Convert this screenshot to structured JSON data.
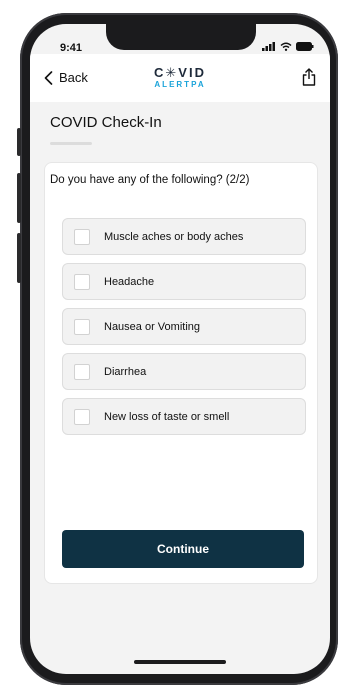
{
  "status_bar": {
    "time": "9:41"
  },
  "nav": {
    "back_label": "Back",
    "logo_top": "C✳VID",
    "logo_bottom": "ALERTPA"
  },
  "page": {
    "title": "COVID Check-In",
    "question": "Do you have any of the following? (2/2)"
  },
  "options": [
    {
      "label": "Muscle aches or body aches",
      "checked": false
    },
    {
      "label": "Headache",
      "checked": false
    },
    {
      "label": "Nausea or Vomiting",
      "checked": false
    },
    {
      "label": "Diarrhea",
      "checked": false
    },
    {
      "label": "New loss of taste or smell",
      "checked": false
    }
  ],
  "actions": {
    "continue_label": "Continue"
  },
  "colors": {
    "primary": "#0f3244",
    "accent": "#1aa3d9",
    "logo_dark": "#1e2a3a"
  }
}
